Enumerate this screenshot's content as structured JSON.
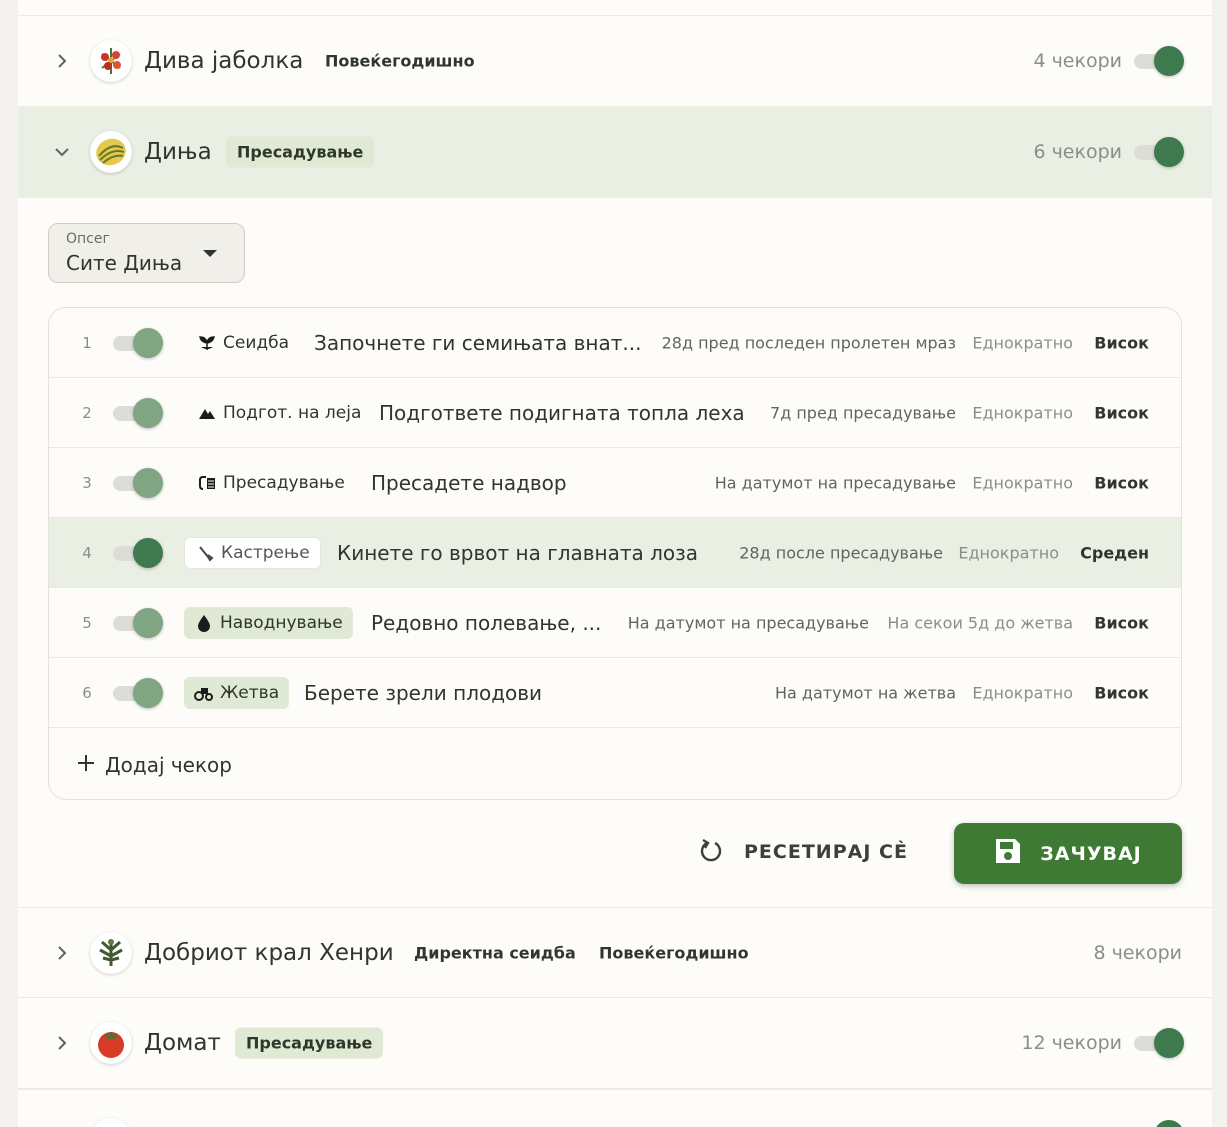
{
  "crops": [
    {
      "name": "Дива јаболка",
      "tags": [
        "Повеќегодишно"
      ],
      "steps": "4 чекори",
      "enabled": true,
      "expanded": false
    },
    {
      "name": "Диња",
      "tags": [
        "Пресадување"
      ],
      "steps": "6 чекори",
      "enabled": true,
      "expanded": true
    },
    {
      "name": "Добриот крал Хенри",
      "tags": [
        "Директна сеидба",
        "Повеќегодишно"
      ],
      "steps": "8 чекори",
      "enabled": false,
      "expanded": false
    },
    {
      "name": "Домат",
      "tags": [
        "Пресадување"
      ],
      "steps": "12 чекори",
      "enabled": true,
      "expanded": false
    }
  ],
  "filter": {
    "label": "Опсег",
    "value": "Сите Диња"
  },
  "steps": [
    {
      "num": "1",
      "category": "Сеидба",
      "category_icon": "sprout-icon",
      "title": "Започнете ги семињата внат...",
      "timing": "28д пред последен пролетен мраз",
      "frequency": "Еднократно",
      "priority": "Висок"
    },
    {
      "num": "2",
      "category": "Подгот. на леја",
      "category_icon": "mountain-icon",
      "title": "Подгответе подигната топла леха",
      "timing": "7д пред пресадување",
      "frequency": "Еднократно",
      "priority": "Висок"
    },
    {
      "num": "3",
      "category": "Пресадување",
      "category_icon": "transplant-icon",
      "title": "Пресадете надвор",
      "timing": "На датумот на пресадување",
      "frequency": "Еднократно",
      "priority": "Висок"
    },
    {
      "num": "4",
      "category": "Кастрење",
      "category_icon": "pruning-icon",
      "title": "Кинете го врвот на главната лоза",
      "timing": "28д после пресадување",
      "frequency": "Еднократно",
      "priority": "Среден"
    },
    {
      "num": "5",
      "category": "Наводнување",
      "category_icon": "water-drop-icon",
      "title": "Редовно полевање, ...",
      "timing": "На датумот на пресадување",
      "frequency": "На секои 5д до жетва",
      "priority": "Висок"
    },
    {
      "num": "6",
      "category": "Жетва",
      "category_icon": "harvest-icon",
      "title": "Берете зрели плодови",
      "timing": "На датумот на жетва",
      "frequency": "Еднократно",
      "priority": "Висок"
    }
  ],
  "add_step_label": "Додај чекор",
  "reset_label": "РЕСЕТИРАЈ СЀ",
  "save_label": "ЗАЧУВАЈ",
  "colors": {
    "accent_green": "#3f7a34",
    "chip_green": "#dfe9d3",
    "highlight": "#eaefe3"
  }
}
